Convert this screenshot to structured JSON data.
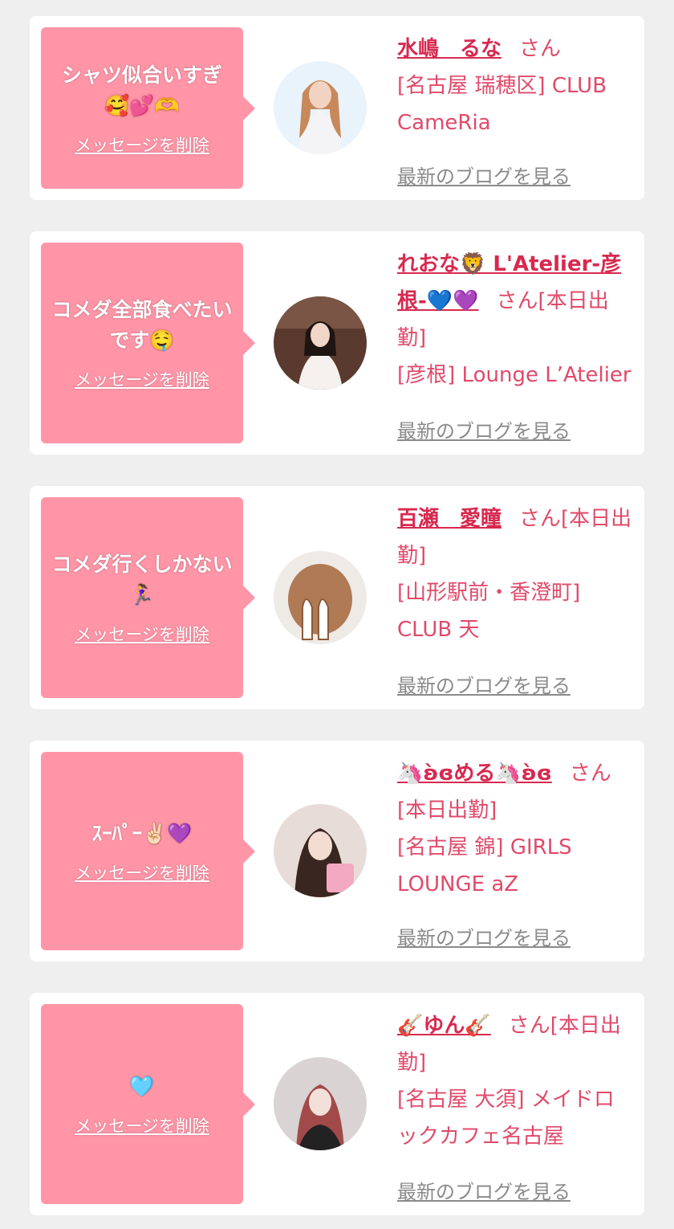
{
  "colors": {
    "page_bg": "#efefef",
    "card_bg": "#ffffff",
    "bubble_bg": "#ff95a7",
    "name": "#d8294f",
    "text": "#e04a6a",
    "link_gray": "#8a8a8a"
  },
  "cards": [
    {
      "message": "シャツ似合いすぎ🥰💕🫶",
      "delete_label": "メッセージを削除",
      "name": "水嶋　るな",
      "san": "さん",
      "store": "[名古屋 瑞穂区] CLUB CameRia",
      "blog_label": "最新のブログを見る"
    },
    {
      "message": "コメダ全部食べたいです🤤",
      "delete_label": "メッセージを削除",
      "name": "れおな🦁 L'Atelier-彦根-💙💜",
      "san": "さん[本日出勤]",
      "store": "[彦根] Lounge L’Atelier",
      "blog_label": "最新のブログを見る"
    },
    {
      "message": "コメダ行くしかない🏃‍♀️",
      "delete_label": "メッセージを削除",
      "name": "百瀬　愛瞳",
      "san": "さん[本日出勤]",
      "store": "[山形駅前・香澄町] CLUB 天",
      "blog_label": "最新のブログを見る"
    },
    {
      "message": "ｽｰﾊﾟｰ✌🏻💜",
      "delete_label": "メッセージを削除",
      "name": "🦄ʚ̀ɞめる🦄ʚ̀ɞ",
      "san": "さん[本日出勤]",
      "store": "[名古屋 錦] GIRLS LOUNGE aZ",
      "blog_label": "最新のブログを見る"
    },
    {
      "message": "🩵",
      "delete_label": "メッセージを削除",
      "name": "🎸ゆん🎸",
      "san": "さん[本日出勤]",
      "store": "[名古屋 大須] メイドロックカフェ名古屋",
      "blog_label": "最新のブログを見る"
    }
  ]
}
